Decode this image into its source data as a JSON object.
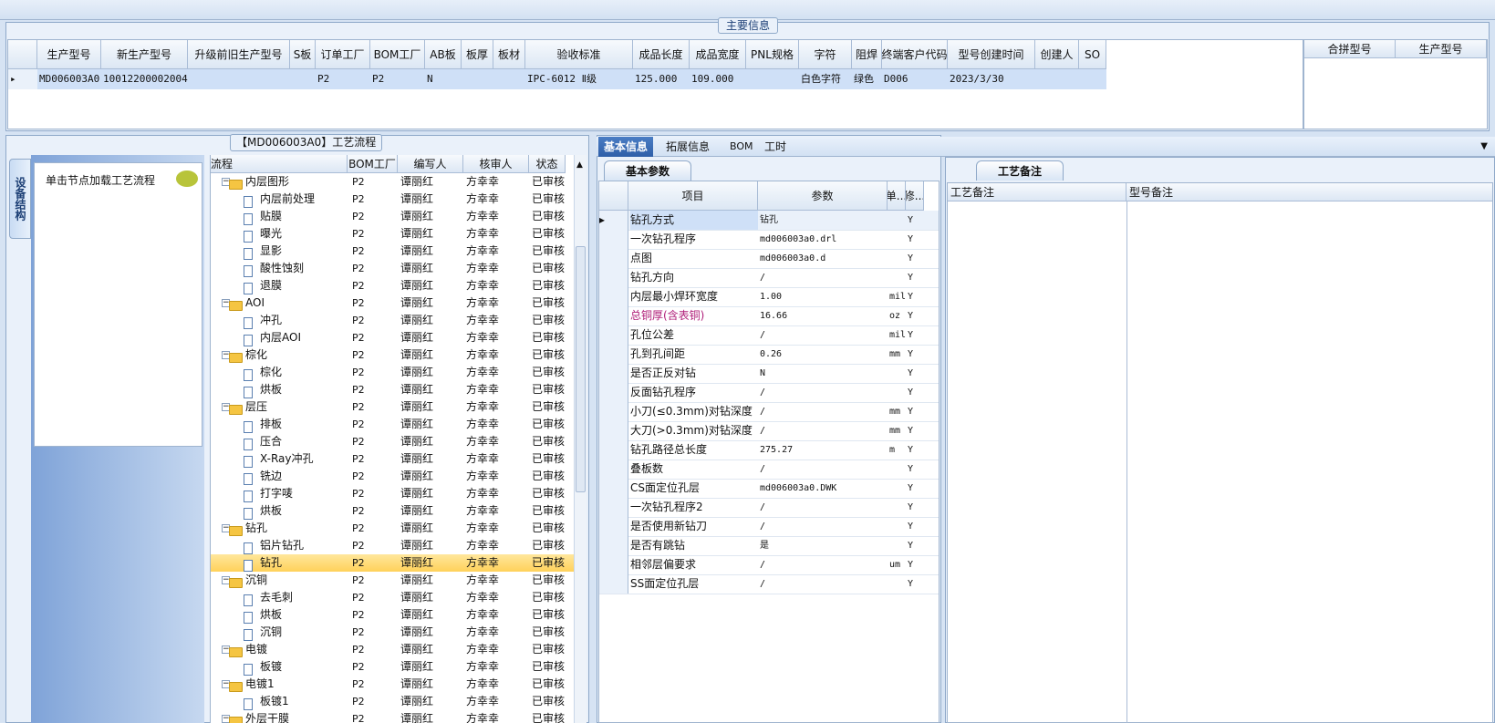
{
  "top_legend": "主要信息",
  "main_grid": {
    "columns": [
      "生产型号",
      "新生产型号",
      "升级前旧生产型号",
      "S板",
      "订单工厂",
      "BOM工厂",
      "AB板",
      "板厚",
      "板材",
      "验收标准",
      "成品长度",
      "成品宽度",
      "PNL规格",
      "字符",
      "阻焊",
      "终端客户代码",
      "型号创建时间",
      "创建人",
      "SO"
    ],
    "row": [
      "MD006003A0",
      "10012200002004",
      "",
      "",
      "P2",
      "P2",
      "N",
      "",
      "",
      "IPC-6012 Ⅱ级",
      "125.000",
      "109.000",
      "",
      "白色字符",
      "绿色",
      "D006",
      "2023/3/30",
      "",
      ""
    ]
  },
  "side_grid": {
    "columns": [
      "合拼型号",
      "生产型号"
    ]
  },
  "left": {
    "vertical_tab": "设备结构",
    "nav_hint": "单击节点加载工艺流程",
    "tree_legend": "【MD006003A0】工艺流程",
    "tree_columns": [
      "流程",
      "BOM工厂",
      "编写人",
      "核审人",
      "状态"
    ],
    "tree_rows": [
      {
        "level": 0,
        "name": "内层图形",
        "bom": "P2",
        "writer": "谭丽红",
        "reviewer": "方幸幸",
        "status": "已审核",
        "folder": true
      },
      {
        "level": 1,
        "name": "内层前处理",
        "bom": "P2",
        "writer": "谭丽红",
        "reviewer": "方幸幸",
        "status": "已审核"
      },
      {
        "level": 1,
        "name": "贴膜",
        "bom": "P2",
        "writer": "谭丽红",
        "reviewer": "方幸幸",
        "status": "已审核"
      },
      {
        "level": 1,
        "name": "曝光",
        "bom": "P2",
        "writer": "谭丽红",
        "reviewer": "方幸幸",
        "status": "已审核"
      },
      {
        "level": 1,
        "name": "显影",
        "bom": "P2",
        "writer": "谭丽红",
        "reviewer": "方幸幸",
        "status": "已审核"
      },
      {
        "level": 1,
        "name": "酸性蚀刻",
        "bom": "P2",
        "writer": "谭丽红",
        "reviewer": "方幸幸",
        "status": "已审核"
      },
      {
        "level": 1,
        "name": "退膜",
        "bom": "P2",
        "writer": "谭丽红",
        "reviewer": "方幸幸",
        "status": "已审核"
      },
      {
        "level": 0,
        "name": "AOI",
        "bom": "P2",
        "writer": "谭丽红",
        "reviewer": "方幸幸",
        "status": "已审核",
        "folder": true
      },
      {
        "level": 1,
        "name": "冲孔",
        "bom": "P2",
        "writer": "谭丽红",
        "reviewer": "方幸幸",
        "status": "已审核"
      },
      {
        "level": 1,
        "name": "内层AOI",
        "bom": "P2",
        "writer": "谭丽红",
        "reviewer": "方幸幸",
        "status": "已审核"
      },
      {
        "level": 0,
        "name": "棕化",
        "bom": "P2",
        "writer": "谭丽红",
        "reviewer": "方幸幸",
        "status": "已审核",
        "folder": true
      },
      {
        "level": 1,
        "name": "棕化",
        "bom": "P2",
        "writer": "谭丽红",
        "reviewer": "方幸幸",
        "status": "已审核"
      },
      {
        "level": 1,
        "name": "烘板",
        "bom": "P2",
        "writer": "谭丽红",
        "reviewer": "方幸幸",
        "status": "已审核"
      },
      {
        "level": 0,
        "name": "层压",
        "bom": "P2",
        "writer": "谭丽红",
        "reviewer": "方幸幸",
        "status": "已审核",
        "folder": true
      },
      {
        "level": 1,
        "name": "排板",
        "bom": "P2",
        "writer": "谭丽红",
        "reviewer": "方幸幸",
        "status": "已审核"
      },
      {
        "level": 1,
        "name": "压合",
        "bom": "P2",
        "writer": "谭丽红",
        "reviewer": "方幸幸",
        "status": "已审核"
      },
      {
        "level": 1,
        "name": "X-Ray冲孔",
        "bom": "P2",
        "writer": "谭丽红",
        "reviewer": "方幸幸",
        "status": "已审核"
      },
      {
        "level": 1,
        "name": "铣边",
        "bom": "P2",
        "writer": "谭丽红",
        "reviewer": "方幸幸",
        "status": "已审核"
      },
      {
        "level": 1,
        "name": "打字唛",
        "bom": "P2",
        "writer": "谭丽红",
        "reviewer": "方幸幸",
        "status": "已审核"
      },
      {
        "level": 1,
        "name": "烘板",
        "bom": "P2",
        "writer": "谭丽红",
        "reviewer": "方幸幸",
        "status": "已审核"
      },
      {
        "level": 0,
        "name": "钻孔",
        "bom": "P2",
        "writer": "谭丽红",
        "reviewer": "方幸幸",
        "status": "已审核",
        "folder": true
      },
      {
        "level": 1,
        "name": "铝片钻孔",
        "bom": "P2",
        "writer": "谭丽红",
        "reviewer": "方幸幸",
        "status": "已审核"
      },
      {
        "level": 1,
        "name": "钻孔",
        "bom": "P2",
        "writer": "谭丽红",
        "reviewer": "方幸幸",
        "status": "已审核",
        "selected": true
      },
      {
        "level": 0,
        "name": "沉铜",
        "bom": "P2",
        "writer": "谭丽红",
        "reviewer": "方幸幸",
        "status": "已审核",
        "folder": true
      },
      {
        "level": 1,
        "name": "去毛刺",
        "bom": "P2",
        "writer": "谭丽红",
        "reviewer": "方幸幸",
        "status": "已审核"
      },
      {
        "level": 1,
        "name": "烘板",
        "bom": "P2",
        "writer": "谭丽红",
        "reviewer": "方幸幸",
        "status": "已审核"
      },
      {
        "level": 1,
        "name": "沉铜",
        "bom": "P2",
        "writer": "谭丽红",
        "reviewer": "方幸幸",
        "status": "已审核"
      },
      {
        "level": 0,
        "name": "电镀",
        "bom": "P2",
        "writer": "谭丽红",
        "reviewer": "方幸幸",
        "status": "已审核",
        "folder": true
      },
      {
        "level": 1,
        "name": "板镀",
        "bom": "P2",
        "writer": "谭丽红",
        "reviewer": "方幸幸",
        "status": "已审核"
      },
      {
        "level": 0,
        "name": "电镀1",
        "bom": "P2",
        "writer": "谭丽红",
        "reviewer": "方幸幸",
        "status": "已审核",
        "folder": true
      },
      {
        "level": 1,
        "name": "板镀1",
        "bom": "P2",
        "writer": "谭丽红",
        "reviewer": "方幸幸",
        "status": "已审核"
      },
      {
        "level": 0,
        "name": "外层干膜",
        "bom": "P2",
        "writer": "谭丽红",
        "reviewer": "方幸幸",
        "status": "已审核",
        "folder": true
      }
    ]
  },
  "tabs": [
    "基本信息",
    "拓展信息",
    "BOM",
    "工时"
  ],
  "params": {
    "subtab": "基本参数",
    "columns": [
      "项目",
      "参数",
      "单...",
      "修..."
    ],
    "rows": [
      {
        "item": "钻孔方式",
        "value": "钻孔",
        "unit": "",
        "mod": "Y"
      },
      {
        "item": "一次钻孔程序",
        "value": "md006003a0.drl",
        "unit": "",
        "mod": "Y"
      },
      {
        "item": "点图",
        "value": "md006003a0.d",
        "unit": "",
        "mod": "Y"
      },
      {
        "item": "钻孔方向",
        "value": "/",
        "unit": "",
        "mod": "Y"
      },
      {
        "item": "内层最小焊环宽度",
        "value": "1.00",
        "unit": "mil",
        "mod": "Y"
      },
      {
        "item": "总铜厚(含表铜)",
        "value": "16.66",
        "unit": "oz",
        "mod": "Y",
        "highlight": "#b0207a"
      },
      {
        "item": "孔位公差",
        "value": "/",
        "unit": "mil",
        "mod": "Y"
      },
      {
        "item": "孔到孔间距",
        "value": "0.26",
        "unit": "mm",
        "mod": "Y"
      },
      {
        "item": "是否正反对钻",
        "value": "N",
        "unit": "",
        "mod": "Y"
      },
      {
        "item": "反面钻孔程序",
        "value": "/",
        "unit": "",
        "mod": "Y"
      },
      {
        "item": "小刀(≤0.3mm)对钻深度",
        "value": "/",
        "unit": "mm",
        "mod": "Y"
      },
      {
        "item": "大刀(>0.3mm)对钻深度",
        "value": "/",
        "unit": "mm",
        "mod": "Y"
      },
      {
        "item": "钻孔路径总长度",
        "value": "275.27",
        "unit": "m",
        "mod": "Y"
      },
      {
        "item": "叠板数",
        "value": "/",
        "unit": "",
        "mod": "Y"
      },
      {
        "item": "CS面定位孔层",
        "value": "md006003a0.DWK",
        "unit": "",
        "mod": "Y"
      },
      {
        "item": "一次钻孔程序2",
        "value": "/",
        "unit": "",
        "mod": "Y"
      },
      {
        "item": "是否使用新钻刀",
        "value": "/",
        "unit": "",
        "mod": "Y"
      },
      {
        "item": "是否有跳钻",
        "value": "是",
        "unit": "",
        "mod": "Y"
      },
      {
        "item": "相邻层偏要求",
        "value": "/",
        "unit": "um",
        "mod": "Y"
      },
      {
        "item": "SS面定位孔层",
        "value": "/",
        "unit": "",
        "mod": "Y"
      }
    ]
  },
  "notes": {
    "subtab": "工艺备注",
    "col1": "工艺备注",
    "col2": "型号备注"
  },
  "colors": {
    "accent": "#2f5fa8",
    "selected_row": "#ffd15a",
    "grid_row_sel": "#cfe0f7"
  }
}
